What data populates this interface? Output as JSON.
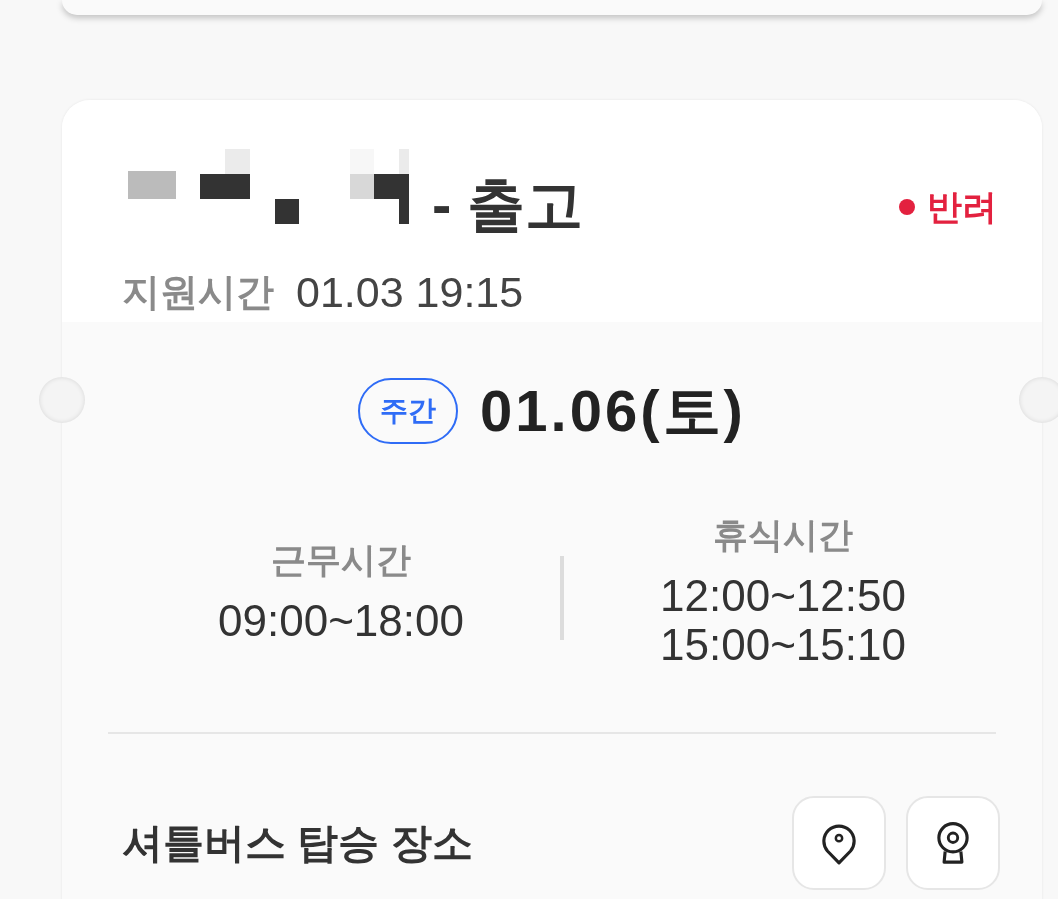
{
  "card": {
    "title": {
      "redacted": true,
      "text": "- 출고"
    },
    "status": {
      "label": "반려",
      "color": "#e3213f"
    },
    "request_time": {
      "label": "지원시간",
      "value": "01.03 19:15"
    },
    "shift": {
      "badge": "주간",
      "date": "01.06(토)"
    },
    "schedule": [
      {
        "label": "근무시간",
        "values": [
          "09:00~18:00"
        ]
      },
      {
        "label": "휴식시간",
        "values": [
          "12:00~12:50",
          "15:00~15:10"
        ]
      }
    ],
    "shuttle": {
      "title": "셔틀버스 탑승 장소",
      "actions": [
        {
          "kind": "map-pin"
        },
        {
          "kind": "camera"
        }
      ]
    }
  }
}
